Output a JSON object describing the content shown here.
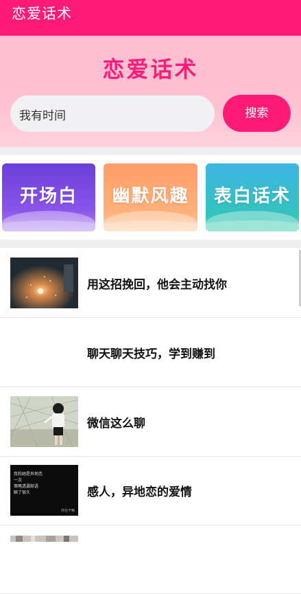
{
  "app_bar": {
    "title": "恋爱话术"
  },
  "hero": {
    "title": "恋爱话术"
  },
  "search": {
    "value": "我有时间",
    "button_label": "搜索"
  },
  "categories": [
    {
      "label": "开场白"
    },
    {
      "label": "幽默风趣"
    },
    {
      "label": "表白话术"
    }
  ],
  "articles": [
    {
      "title": "用这招挽回，他会主动找你",
      "thumb": "sparkler-photo"
    },
    {
      "title": "聊天聊天技巧，学到赚到",
      "thumb": ""
    },
    {
      "title": "微信这么聊",
      "thumb": "girl-photo"
    },
    {
      "title": "感人，异地恋的爱情",
      "thumb": "quote-image",
      "thumb_text": [
        "我和她是异地恋",
        "一次",
        "策略透漏邮语",
        "聊了很久"
      ],
      "thumb_caption": "你在干嘛"
    },
    {
      "title": "",
      "thumb": "partial-photo"
    }
  ]
}
